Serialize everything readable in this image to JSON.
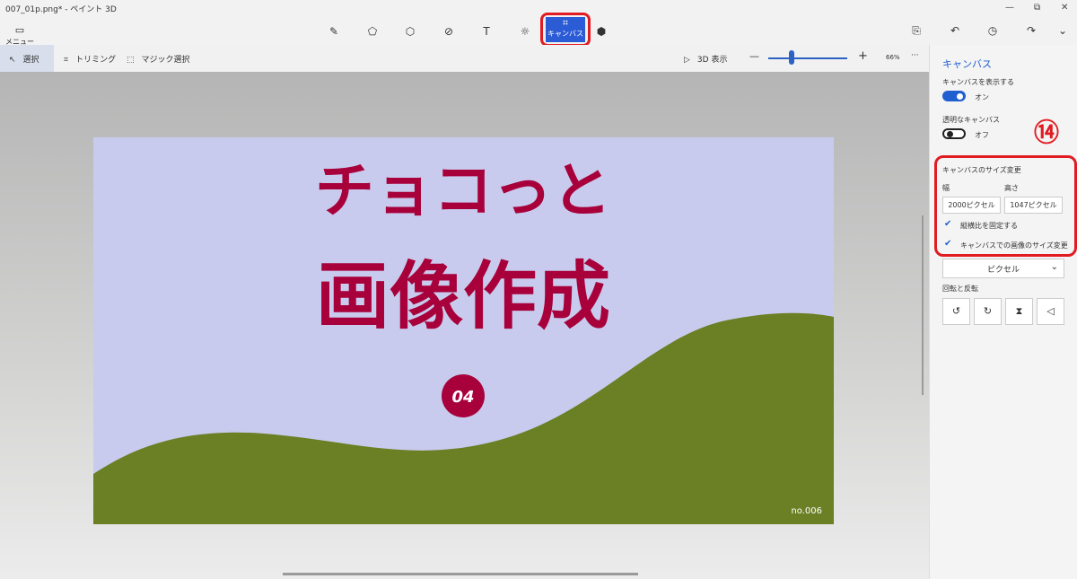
{
  "window": {
    "title": "007_01p.png* - ペイント 3D",
    "minimize": "—",
    "restore": "⧉",
    "close": "✕"
  },
  "menu": {
    "label": "メニュー"
  },
  "tools": {
    "canvas_label": "キャンバス"
  },
  "toolbar": {
    "select": "選択",
    "crop": "トリミング",
    "magic_select": "マジック選択",
    "view3d": "3D 表示",
    "zoom_minus": "—",
    "zoom_plus": "+",
    "zoom_level": "66%",
    "more": "···"
  },
  "zoom": {
    "level_fraction": 0.3
  },
  "artwork": {
    "line1": "チョコっと",
    "line2": "画像作成",
    "badge": "04",
    "footer": "no.006"
  },
  "panel": {
    "title": "キャンバス",
    "show_canvas_label": "キャンバスを表示する",
    "show_canvas_state": "オン",
    "transparent_label": "透明なキャンバス",
    "transparent_state": "オフ",
    "annotation": "⑭",
    "resize_title": "キャンバスのサイズ変更",
    "width_label": "幅",
    "height_label": "高さ",
    "width_value": "2000ピクセル",
    "height_value": "1047ピクセル",
    "lock_aspect": "縦横比を固定する",
    "resize_image": "キャンバスでの画像のサイズ変更",
    "unit": "ピクセル",
    "rotate_label": "回転と反転"
  },
  "colors": {
    "accent": "#1f5fcf",
    "highlight": "#e11b22",
    "art_sky": "#c8cbed",
    "art_hill": "#6b7f24",
    "art_text": "#a8003a"
  }
}
